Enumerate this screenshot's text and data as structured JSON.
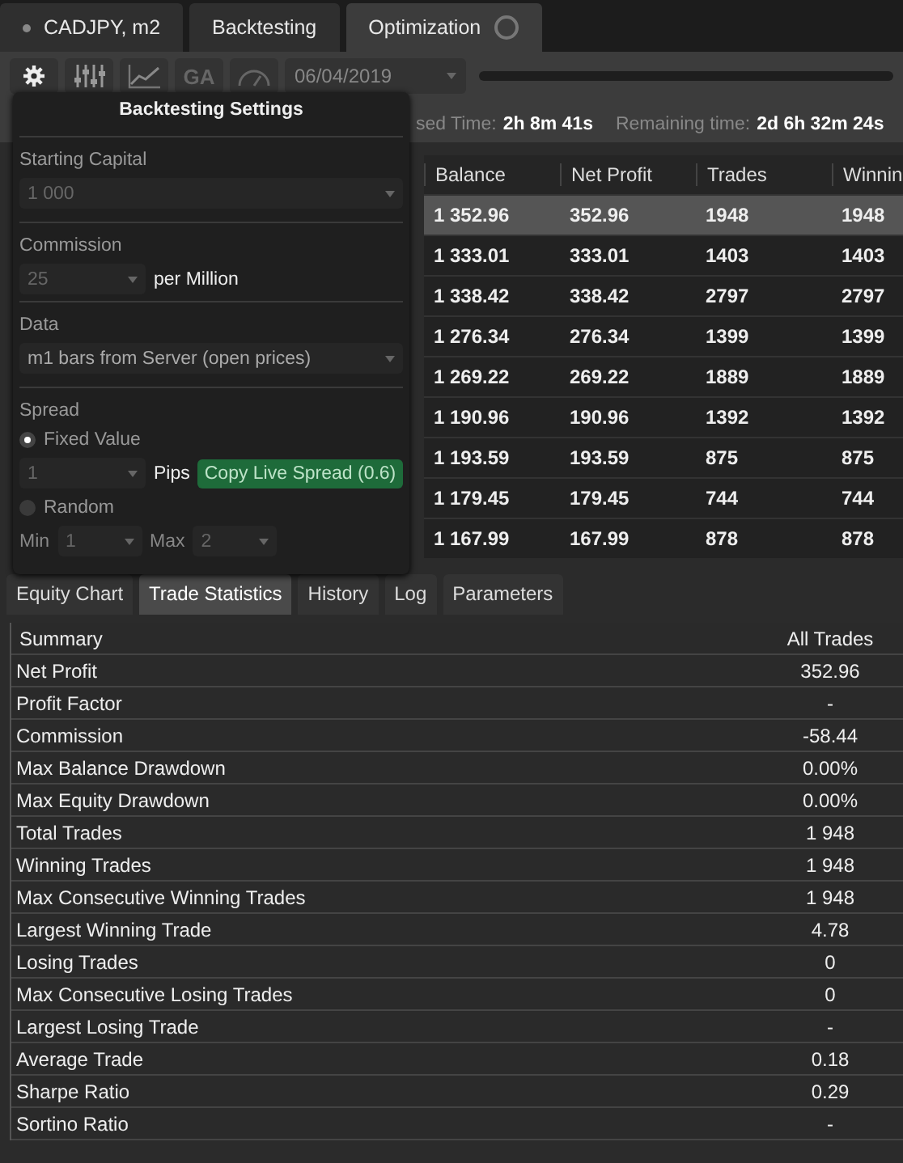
{
  "tabs": [
    {
      "label": "CADJPY, m2",
      "selected": false,
      "kind": "symbol"
    },
    {
      "label": "Backtesting",
      "selected": false,
      "kind": "plain"
    },
    {
      "label": "Optimization",
      "selected": true,
      "kind": "running"
    }
  ],
  "toolbar": {
    "buttons": [
      {
        "kind": "gear"
      },
      {
        "kind": "sliders"
      },
      {
        "kind": "chart"
      },
      {
        "kind": "text",
        "label": "GA"
      },
      {
        "kind": "gauge"
      }
    ],
    "date": "06/04/2019",
    "progress": {
      "level": 0
    }
  },
  "timing": [
    {
      "label": "sed Time:",
      "value": "2h 8m 41s"
    },
    {
      "label": "Remaining time:",
      "value": "2d 6h 32m 24s"
    }
  ],
  "results": {
    "columns": [
      "Balance",
      "Net Profit",
      "Trades",
      "Winnin"
    ],
    "rows": [
      {
        "cells": [
          "1 352.96",
          "352.96",
          "1948",
          "1948"
        ],
        "selected": true
      },
      {
        "cells": [
          "1 333.01",
          "333.01",
          "1403",
          "1403"
        ],
        "selected": false
      },
      {
        "cells": [
          "1 338.42",
          "338.42",
          "2797",
          "2797"
        ],
        "selected": false
      },
      {
        "cells": [
          "1 276.34",
          "276.34",
          "1399",
          "1399"
        ],
        "selected": false
      },
      {
        "cells": [
          "1 269.22",
          "269.22",
          "1889",
          "1889"
        ],
        "selected": false
      },
      {
        "cells": [
          "1 190.96",
          "190.96",
          "1392",
          "1392"
        ],
        "selected": false
      },
      {
        "cells": [
          "1 193.59",
          "193.59",
          "875",
          "875"
        ],
        "selected": false
      },
      {
        "cells": [
          "1 179.45",
          "179.45",
          "744",
          "744"
        ],
        "selected": false
      },
      {
        "cells": [
          "1 167.99",
          "167.99",
          "878",
          "878"
        ],
        "selected": false
      }
    ]
  },
  "settings": {
    "title": "Backtesting Settings",
    "starting_capital": {
      "label": "Starting Capital",
      "value": "1 000"
    },
    "commission": {
      "label": "Commission",
      "value": "25",
      "unit": "per Million"
    },
    "data": {
      "label": "Data",
      "value": "m1 bars from Server (open prices)"
    },
    "spread": {
      "label": "Spread",
      "options": [
        {
          "label": "Fixed Value",
          "selected": true
        },
        {
          "label": "Random",
          "selected": false
        }
      ],
      "fixed": {
        "value": "1",
        "unit": "Pips",
        "button": "Copy Live Spread (0.6)"
      },
      "min": {
        "label": "Min",
        "value": "1"
      },
      "max": {
        "label": "Max",
        "value": "2"
      }
    }
  },
  "bottom_tabs": [
    {
      "label": "Equity Chart",
      "selected": false
    },
    {
      "label": "Trade Statistics",
      "selected": true
    },
    {
      "label": "History",
      "selected": false
    },
    {
      "label": "Log",
      "selected": false
    },
    {
      "label": "Parameters",
      "selected": false
    }
  ],
  "stats": {
    "columns": [
      "Summary",
      "All Trades"
    ],
    "rows": [
      [
        "Net Profit",
        "352.96"
      ],
      [
        "Profit Factor",
        "-"
      ],
      [
        "Commission",
        "-58.44"
      ],
      [
        "Max Balance Drawdown",
        "0.00%"
      ],
      [
        "Max Equity Drawdown",
        "0.00%"
      ],
      [
        "Total Trades",
        "1 948"
      ],
      [
        "Winning Trades",
        "1 948"
      ],
      [
        "Max Consecutive Winning Trades",
        "1 948"
      ],
      [
        "Largest Winning Trade",
        "4.78"
      ],
      [
        "Losing Trades",
        "0"
      ],
      [
        "Max Consecutive Losing Trades",
        "0"
      ],
      [
        "Largest Losing Trade",
        "-"
      ],
      [
        "Average Trade",
        "0.18"
      ],
      [
        "Sharpe Ratio",
        "0.29"
      ],
      [
        "Sortino Ratio",
        "-"
      ]
    ]
  }
}
